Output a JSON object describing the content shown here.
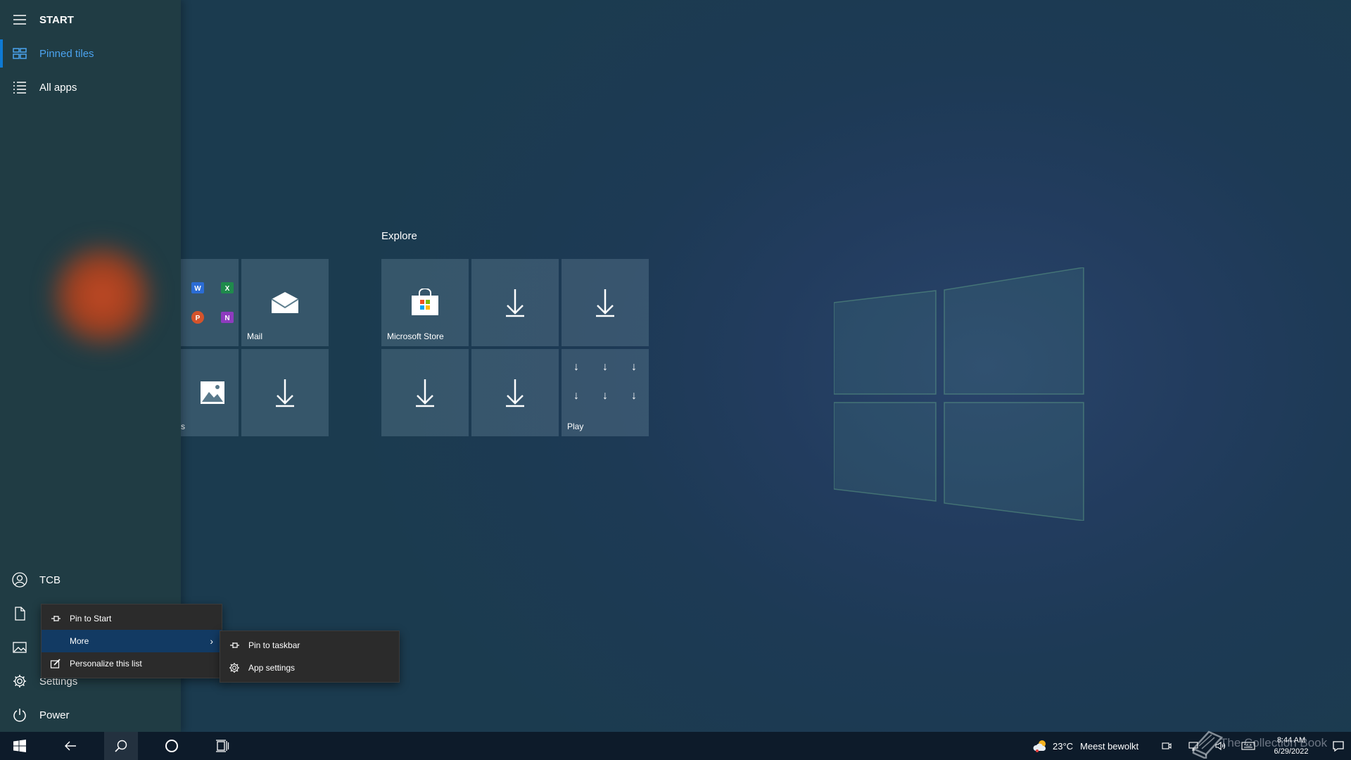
{
  "sidebar": {
    "title": "START",
    "nav": [
      {
        "label": "Pinned tiles",
        "icon": "tiles-icon",
        "selected": true
      },
      {
        "label": "All apps",
        "icon": "list-icon",
        "selected": false
      }
    ],
    "user": {
      "label": "TCB",
      "icon": "user-icon"
    },
    "bottom": [
      {
        "label": "Documents",
        "icon": "document-icon"
      },
      {
        "label": "Pictures",
        "icon": "picture-icon"
      },
      {
        "label": "Settings",
        "icon": "gear-icon"
      },
      {
        "label": "Power",
        "icon": "power-icon"
      }
    ]
  },
  "tiles": {
    "group1": {
      "mail_label": "Mail",
      "photos_label": "s",
      "office_icons": [
        "W",
        "X",
        "P",
        "N"
      ]
    },
    "group2": {
      "header": "Explore",
      "store_label": "Microsoft Store",
      "play_label": "Play"
    }
  },
  "context_menu": {
    "items": [
      {
        "label": "Pin to Start",
        "icon": "pin-icon"
      },
      {
        "label": "More",
        "icon": "",
        "active": true
      },
      {
        "label": "Personalize this list",
        "icon": "edit-icon"
      }
    ],
    "more_arrow": "›"
  },
  "submenu": {
    "items": [
      {
        "label": "Pin to taskbar",
        "icon": "pin-icon"
      },
      {
        "label": "App settings",
        "icon": "gear-icon"
      }
    ]
  },
  "taskbar": {
    "weather_temp": "23°C",
    "weather_desc": "Meest bewolkt",
    "time": "8:44 AM",
    "date": "6/29/2022"
  },
  "watermark": "The Collection Book",
  "colors": {
    "accent": "#0e7ad4",
    "selected_text": "#4ba3ef",
    "menu_bg": "#2b2b2b",
    "menu_active": "#123a63"
  }
}
